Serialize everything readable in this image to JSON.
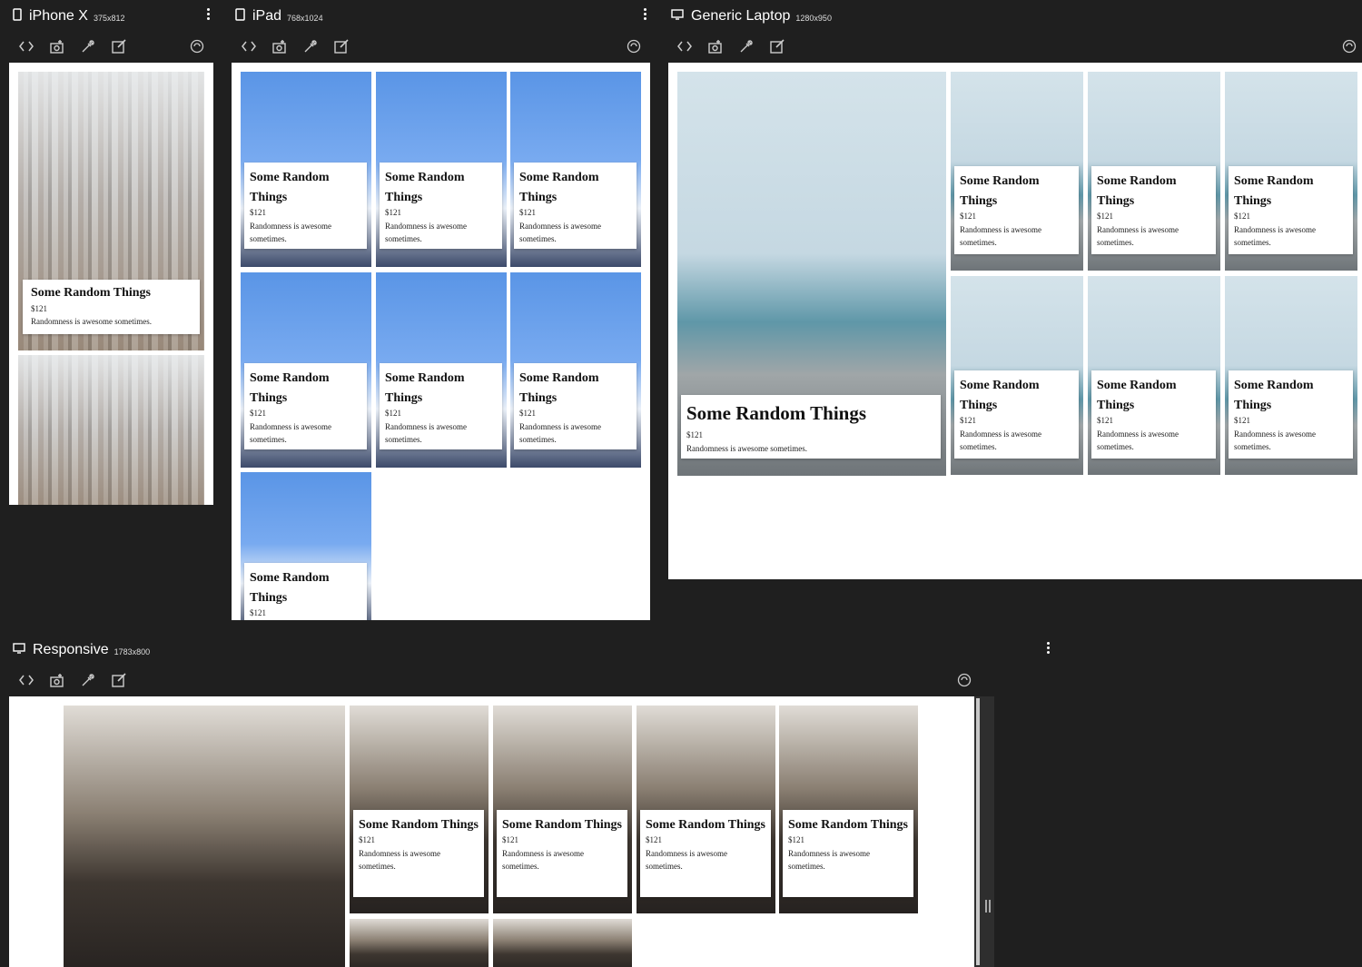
{
  "toolbar_icons": [
    "code-icon",
    "screenshot-icon",
    "eyedropper-icon",
    "edit-icon"
  ],
  "devices": {
    "iphone": {
      "name": "iPhone X",
      "size": "375x812"
    },
    "ipad": {
      "name": "iPad",
      "size": "768x1024"
    },
    "laptop": {
      "name": "Generic Laptop",
      "size": "1280x950"
    },
    "responsive": {
      "name": "Responsive",
      "size": "1783x800"
    }
  },
  "card": {
    "title": "Some Random Things",
    "price": "$121",
    "description": "Randomness is awesome sometimes."
  },
  "colors": {
    "chrome_bg": "#1f1f1f",
    "screen_bg": "#ffffff"
  }
}
